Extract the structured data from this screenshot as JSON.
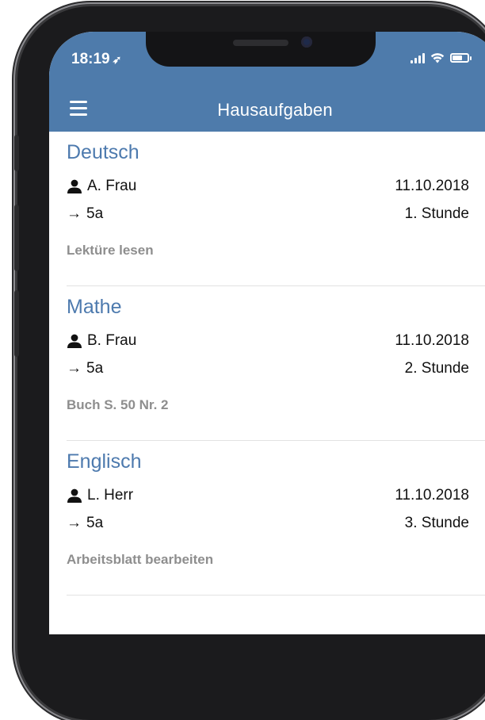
{
  "status_bar": {
    "time": "18:19",
    "location_icon": "location-arrow-icon",
    "signal_icon": "signal-icon",
    "wifi_icon": "wifi-icon",
    "battery_icon": "battery-icon",
    "battery_level": 0.65
  },
  "header": {
    "title": "Hausaufgaben",
    "menu_icon": "hamburger-menu-icon"
  },
  "colors": {
    "accent": "#4e7bab",
    "subject_text": "#4d7aae",
    "description_text": "#8e8e8e",
    "divider": "#e2e2e2"
  },
  "homework": [
    {
      "subject": "Deutsch",
      "teacher": "A. Frau",
      "date": "11.10.2018",
      "class": "5a",
      "period": "1. Stunde",
      "description": "Lektüre lesen"
    },
    {
      "subject": "Mathe",
      "teacher": "B. Frau",
      "date": "11.10.2018",
      "class": "5a",
      "period": "2. Stunde",
      "description": "Buch S. 50 Nr. 2"
    },
    {
      "subject": "Englisch",
      "teacher": "L. Herr",
      "date": "11.10.2018",
      "class": "5a",
      "period": "3. Stunde",
      "description": "Arbeitsblatt bearbeiten"
    }
  ]
}
